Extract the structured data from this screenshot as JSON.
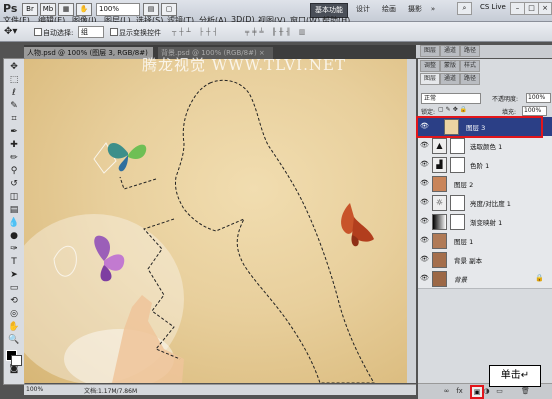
{
  "app": {
    "logo": "Ps"
  },
  "menu": [
    "文件(F)",
    "编辑(E)",
    "图像(I)",
    "图层(L)",
    "选择(S)",
    "滤镜(T)",
    "分析(A)",
    "3D(D)",
    "视图(V)",
    "窗口(W)",
    "帮助(H)"
  ],
  "topbar": {
    "zoom": "100%",
    "workspace_basic": "基本功能",
    "workspace_design": "设计",
    "workspace_paint": "绘画",
    "workspace_more": "摄影",
    "cs_live": "CS Live"
  },
  "options": {
    "auto_select": "自动选择:",
    "auto_select_value": "组",
    "show_transform": "显示变换控件"
  },
  "tabs": [
    {
      "label": "人物.psd @ 100% (图层 3, RGB/8#) *"
    },
    {
      "label": "背景.psd @ 100% (RGB/8#) ×"
    }
  ],
  "watermark": "腾龙视觉 WWW.TLVI.NET",
  "status": {
    "zoom": "100%",
    "doc": "文档:1.17M/7.86M"
  },
  "panel": {
    "tabs_top": [
      "图层",
      "通道",
      "路径"
    ],
    "tabs_second": [
      "调整",
      "蒙版",
      "样式"
    ],
    "blend_mode": "正常",
    "opacity_label": "不透明度:",
    "opacity_value": "100%",
    "lock_label": "锁定:",
    "fill_label": "填充:",
    "fill_value": "100%"
  },
  "layers": [
    {
      "name": "图层 3",
      "selected": true,
      "kind": "pixel"
    },
    {
      "name": "选取颜色 1",
      "selected": false,
      "kind": "adjust"
    },
    {
      "name": "色阶 1",
      "selected": false,
      "kind": "adjust"
    },
    {
      "name": "图层 2",
      "selected": false,
      "kind": "pixel"
    },
    {
      "name": "亮度/对比度 1",
      "selected": false,
      "kind": "adjust"
    },
    {
      "name": "渐变映射 1",
      "selected": false,
      "kind": "adjust"
    },
    {
      "name": "图层 1",
      "selected": false,
      "kind": "pixel"
    },
    {
      "name": "背景 副本",
      "selected": false,
      "kind": "pixel"
    },
    {
      "name": "背景",
      "selected": false,
      "kind": "pixel"
    }
  ],
  "callout": "单击↵",
  "colors": {
    "selection": "#2b3f86",
    "highlight": "#e2161b",
    "canvas": "#e8cf9c"
  }
}
